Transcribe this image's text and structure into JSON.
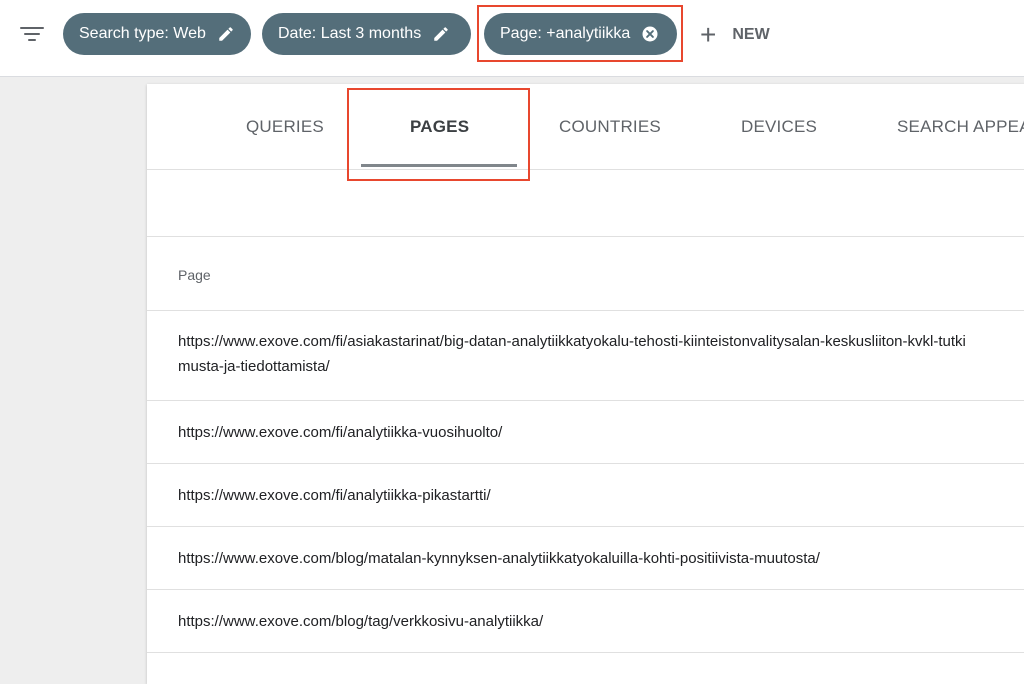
{
  "filters": {
    "chips": [
      {
        "label": "Search type: Web",
        "icon": "pencil-icon"
      },
      {
        "label": "Date: Last 3 months",
        "icon": "pencil-icon"
      },
      {
        "label": "Page: +analytiikka",
        "icon": "close-circle-icon"
      }
    ],
    "new_label": "NEW"
  },
  "tabs": [
    {
      "label": "QUERIES"
    },
    {
      "label": "PAGES",
      "active": true
    },
    {
      "label": "COUNTRIES"
    },
    {
      "label": "DEVICES"
    },
    {
      "label": "SEARCH APPEA"
    }
  ],
  "table": {
    "column_header": "Page",
    "rows": [
      "https://www.exove.com/fi/asiakastarinat/big-datan-analytiikkatyokalu-tehosti-kiinteistonvalitysalan-keskusliiton-kvkl-tutkimusta-ja-tiedottamista/",
      "https://www.exove.com/fi/analytiikka-vuosihuolto/",
      "https://www.exove.com/fi/analytiikka-pikastartti/",
      "https://www.exove.com/blog/matalan-kynnyksen-analytiikkatyokaluilla-kohti-positiivista-muutosta/",
      "https://www.exove.com/blog/tag/verkkosivu-analytiikka/"
    ]
  },
  "colors": {
    "chip_bg": "#546e7a",
    "highlight": "#e8472e"
  }
}
